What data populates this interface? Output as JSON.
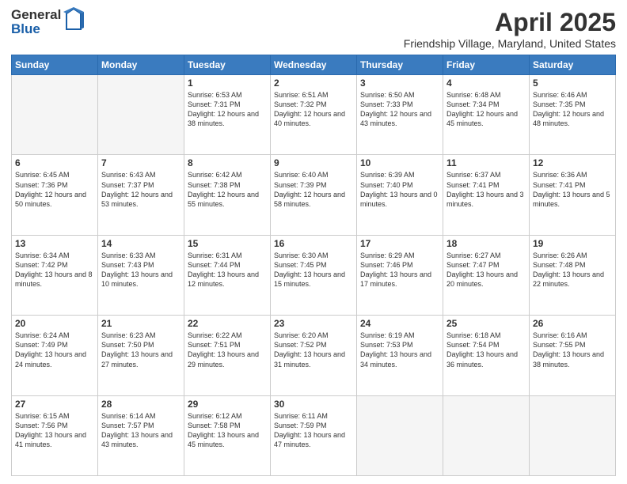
{
  "logo": {
    "general": "General",
    "blue": "Blue"
  },
  "title": "April 2025",
  "subtitle": "Friendship Village, Maryland, United States",
  "days_of_week": [
    "Sunday",
    "Monday",
    "Tuesday",
    "Wednesday",
    "Thursday",
    "Friday",
    "Saturday"
  ],
  "weeks": [
    [
      {
        "day": "",
        "info": ""
      },
      {
        "day": "",
        "info": ""
      },
      {
        "day": "1",
        "info": "Sunrise: 6:53 AM\nSunset: 7:31 PM\nDaylight: 12 hours and 38 minutes."
      },
      {
        "day": "2",
        "info": "Sunrise: 6:51 AM\nSunset: 7:32 PM\nDaylight: 12 hours and 40 minutes."
      },
      {
        "day": "3",
        "info": "Sunrise: 6:50 AM\nSunset: 7:33 PM\nDaylight: 12 hours and 43 minutes."
      },
      {
        "day": "4",
        "info": "Sunrise: 6:48 AM\nSunset: 7:34 PM\nDaylight: 12 hours and 45 minutes."
      },
      {
        "day": "5",
        "info": "Sunrise: 6:46 AM\nSunset: 7:35 PM\nDaylight: 12 hours and 48 minutes."
      }
    ],
    [
      {
        "day": "6",
        "info": "Sunrise: 6:45 AM\nSunset: 7:36 PM\nDaylight: 12 hours and 50 minutes."
      },
      {
        "day": "7",
        "info": "Sunrise: 6:43 AM\nSunset: 7:37 PM\nDaylight: 12 hours and 53 minutes."
      },
      {
        "day": "8",
        "info": "Sunrise: 6:42 AM\nSunset: 7:38 PM\nDaylight: 12 hours and 55 minutes."
      },
      {
        "day": "9",
        "info": "Sunrise: 6:40 AM\nSunset: 7:39 PM\nDaylight: 12 hours and 58 minutes."
      },
      {
        "day": "10",
        "info": "Sunrise: 6:39 AM\nSunset: 7:40 PM\nDaylight: 13 hours and 0 minutes."
      },
      {
        "day": "11",
        "info": "Sunrise: 6:37 AM\nSunset: 7:41 PM\nDaylight: 13 hours and 3 minutes."
      },
      {
        "day": "12",
        "info": "Sunrise: 6:36 AM\nSunset: 7:41 PM\nDaylight: 13 hours and 5 minutes."
      }
    ],
    [
      {
        "day": "13",
        "info": "Sunrise: 6:34 AM\nSunset: 7:42 PM\nDaylight: 13 hours and 8 minutes."
      },
      {
        "day": "14",
        "info": "Sunrise: 6:33 AM\nSunset: 7:43 PM\nDaylight: 13 hours and 10 minutes."
      },
      {
        "day": "15",
        "info": "Sunrise: 6:31 AM\nSunset: 7:44 PM\nDaylight: 13 hours and 12 minutes."
      },
      {
        "day": "16",
        "info": "Sunrise: 6:30 AM\nSunset: 7:45 PM\nDaylight: 13 hours and 15 minutes."
      },
      {
        "day": "17",
        "info": "Sunrise: 6:29 AM\nSunset: 7:46 PM\nDaylight: 13 hours and 17 minutes."
      },
      {
        "day": "18",
        "info": "Sunrise: 6:27 AM\nSunset: 7:47 PM\nDaylight: 13 hours and 20 minutes."
      },
      {
        "day": "19",
        "info": "Sunrise: 6:26 AM\nSunset: 7:48 PM\nDaylight: 13 hours and 22 minutes."
      }
    ],
    [
      {
        "day": "20",
        "info": "Sunrise: 6:24 AM\nSunset: 7:49 PM\nDaylight: 13 hours and 24 minutes."
      },
      {
        "day": "21",
        "info": "Sunrise: 6:23 AM\nSunset: 7:50 PM\nDaylight: 13 hours and 27 minutes."
      },
      {
        "day": "22",
        "info": "Sunrise: 6:22 AM\nSunset: 7:51 PM\nDaylight: 13 hours and 29 minutes."
      },
      {
        "day": "23",
        "info": "Sunrise: 6:20 AM\nSunset: 7:52 PM\nDaylight: 13 hours and 31 minutes."
      },
      {
        "day": "24",
        "info": "Sunrise: 6:19 AM\nSunset: 7:53 PM\nDaylight: 13 hours and 34 minutes."
      },
      {
        "day": "25",
        "info": "Sunrise: 6:18 AM\nSunset: 7:54 PM\nDaylight: 13 hours and 36 minutes."
      },
      {
        "day": "26",
        "info": "Sunrise: 6:16 AM\nSunset: 7:55 PM\nDaylight: 13 hours and 38 minutes."
      }
    ],
    [
      {
        "day": "27",
        "info": "Sunrise: 6:15 AM\nSunset: 7:56 PM\nDaylight: 13 hours and 41 minutes."
      },
      {
        "day": "28",
        "info": "Sunrise: 6:14 AM\nSunset: 7:57 PM\nDaylight: 13 hours and 43 minutes."
      },
      {
        "day": "29",
        "info": "Sunrise: 6:12 AM\nSunset: 7:58 PM\nDaylight: 13 hours and 45 minutes."
      },
      {
        "day": "30",
        "info": "Sunrise: 6:11 AM\nSunset: 7:59 PM\nDaylight: 13 hours and 47 minutes."
      },
      {
        "day": "",
        "info": ""
      },
      {
        "day": "",
        "info": ""
      },
      {
        "day": "",
        "info": ""
      }
    ]
  ]
}
